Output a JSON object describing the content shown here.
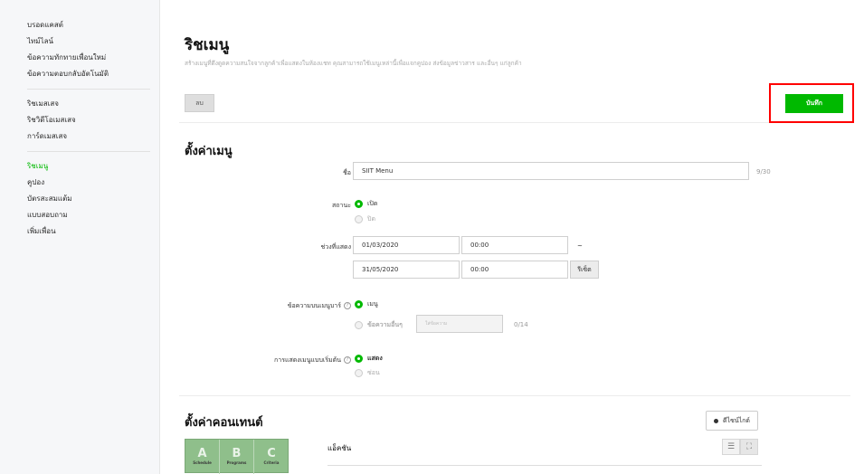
{
  "sidebar": {
    "group1": [
      "บรอดแคสต์",
      "ไทม์ไลน์",
      "ข้อความทักทายเพื่อนใหม่",
      "ข้อความตอบกลับอัตโนมัติ"
    ],
    "group2": [
      "ริชเมสเสจ",
      "ริชวิดีโอเมสเสจ",
      "การ์ดเมสเสจ"
    ],
    "group3": [
      "ริชเมนู",
      "คูปอง",
      "บัตรสะสมแต้ม",
      "แบบสอบถาม",
      "เพิ่มเพื่อน"
    ]
  },
  "header": {
    "title": "ริชเมนู",
    "description": "สร้างเมนูที่ดึงดูดความสนใจจากลูกค้าเพื่อแสดงในห้องแชท คุณสามารถใช้เมนูเหล่านี้เพื่อแจกคูปอง ส่งข้อมูลข่าวสาร และอื่นๆ แก่ลูกค้า"
  },
  "toolbar": {
    "delete_label": "ลบ",
    "save_label": "บันทึก"
  },
  "menu_settings": {
    "section_title": "ตั้งค่าเมนู",
    "name_label": "ชื่อ",
    "name_value": "SIIT Menu",
    "name_counter": "9/30",
    "status_label": "สถานะ",
    "status_on": "เปิด",
    "status_off": "ปิด",
    "period_label": "ช่วงที่แสดง",
    "start_date": "01/03/2020",
    "start_time": "00:00",
    "tilde": "~",
    "end_date": "31/05/2020",
    "end_time": "00:00",
    "reset_label": "รีเซ็ต",
    "menubar_label": "ข้อความบนเมนูบาร์",
    "menubar_opt1": "เมนู",
    "menubar_opt2": "ข้อความอื่นๆ",
    "menubar_placeholder": "ใส่ข้อความ",
    "menubar_counter": "0/14",
    "default_label": "การแสดงเมนูแบบเริ่มต้น",
    "default_show": "แสดง",
    "default_hide": "ซ่อน",
    "help_icon": "?"
  },
  "content_settings": {
    "section_title": "ตั้งค่าคอนเทนต์",
    "design_button": "ดีไซน์ไกด์",
    "action_label": "แอ็คชัน",
    "template_cells": [
      {
        "letter": "A",
        "caption": "Schedule"
      },
      {
        "letter": "B",
        "caption": "Programs"
      },
      {
        "letter": "C",
        "caption": "Criteria"
      }
    ],
    "view_icons": [
      "☰",
      "⛶"
    ]
  }
}
